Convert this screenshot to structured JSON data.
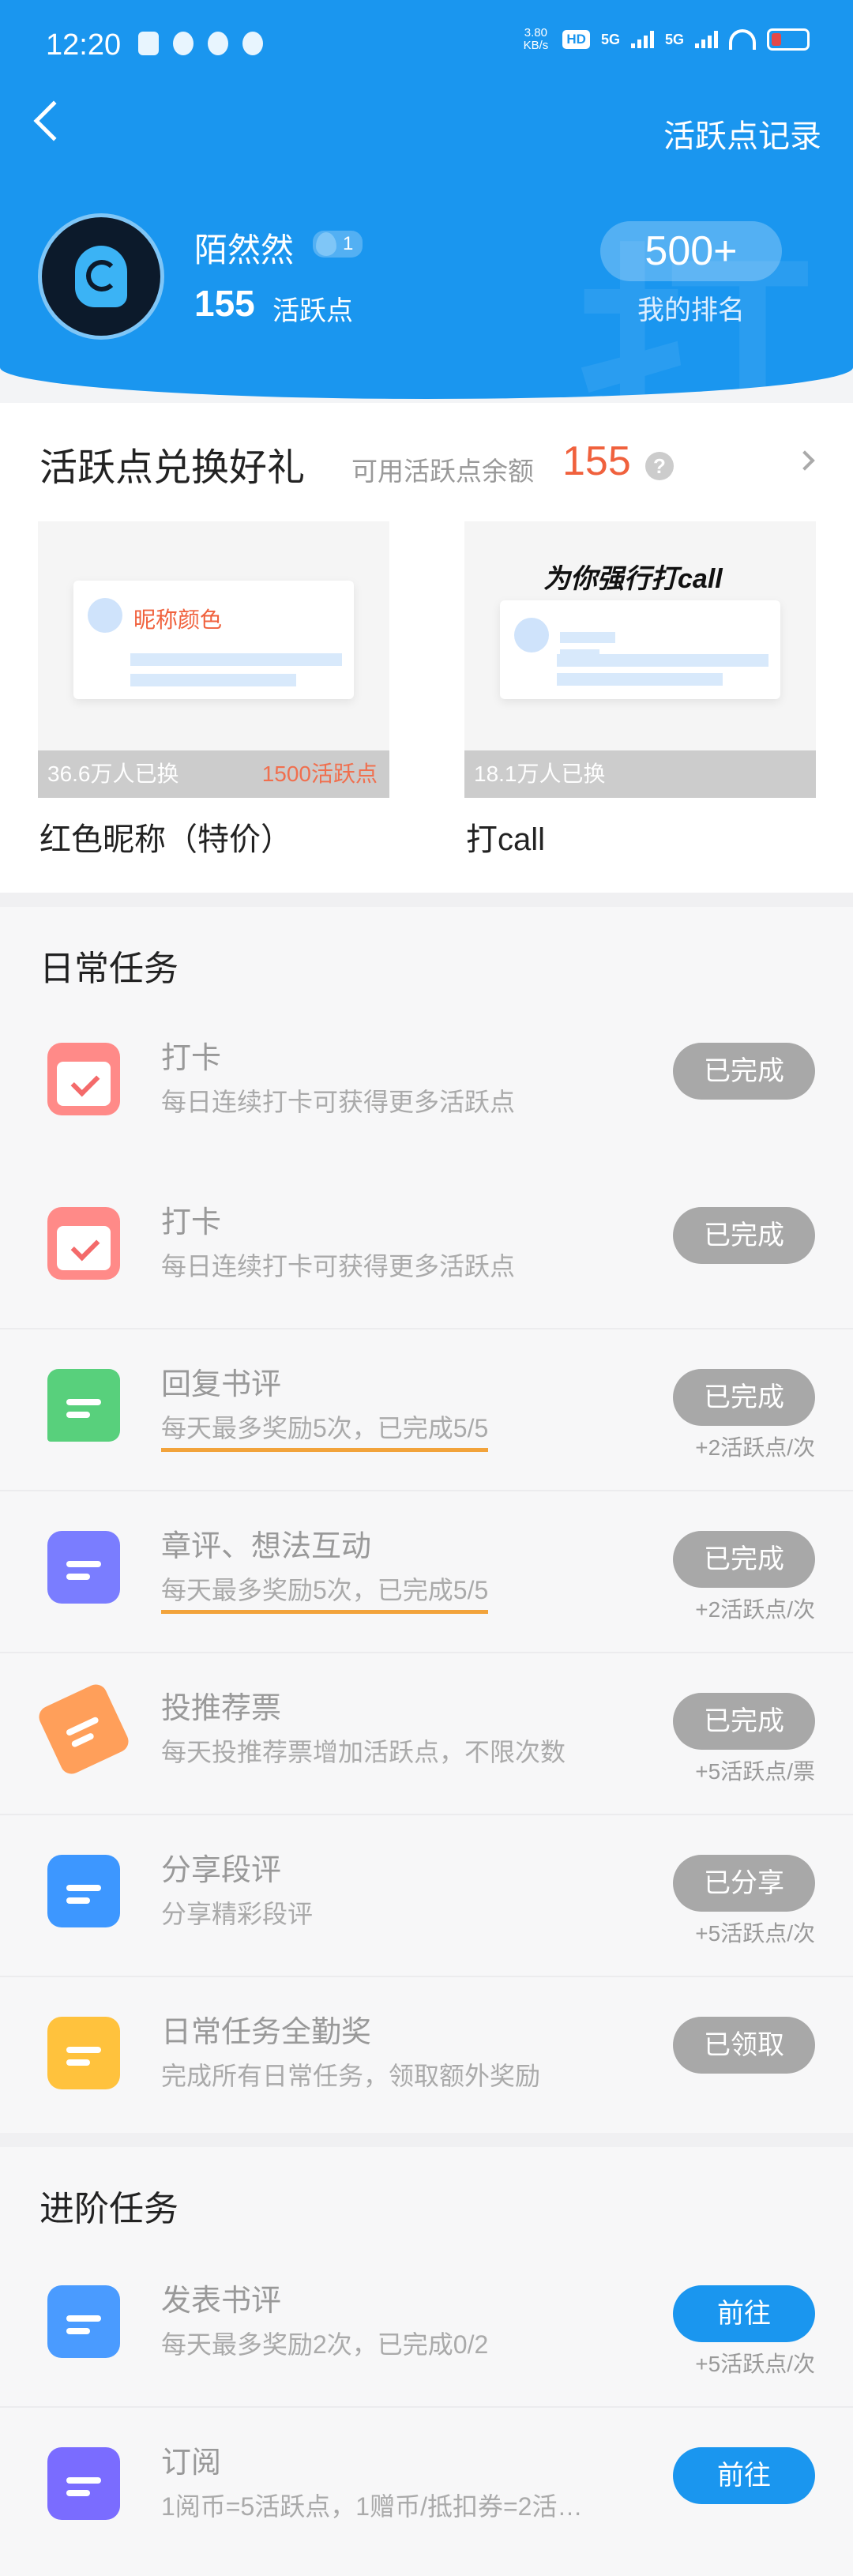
{
  "status_bar": {
    "time": "12:20",
    "net_speed": "3.80 KB/s",
    "hd": "HD",
    "sig1": "5G",
    "sig2": "5G"
  },
  "header": {
    "back": "back",
    "records_link": "活跃点记录"
  },
  "profile": {
    "name": "陌然然",
    "level": "1",
    "points": "155",
    "points_label": "活跃点",
    "rank": "500+",
    "rank_label": "我的排名"
  },
  "redeem": {
    "title": "活跃点兑换好礼",
    "available_label": "可用活跃点余额",
    "balance": "155",
    "items": [
      {
        "name": "红色昵称（特价）",
        "exchanged": "36.6万人已换",
        "cost": "1500活跃点",
        "preview_text": "昵称颜色"
      },
      {
        "name": "打call",
        "exchanged": "18.1万人已换",
        "cost": "",
        "preview_text": "为你强行打call"
      }
    ]
  },
  "daily": {
    "title": "日常任务",
    "tasks": [
      {
        "name": "打卡",
        "desc": "每日连续打卡可获得更多活跃点",
        "button": "已完成",
        "reward": ""
      },
      {
        "name": "打卡",
        "desc": "每日连续打卡可获得更多活跃点",
        "button": "已完成",
        "reward": ""
      },
      {
        "name": "回复书评",
        "desc": "每天最多奖励5次，已完成5/5",
        "button": "已完成",
        "reward": "+2活跃点/次"
      },
      {
        "name": "章评、想法互动",
        "desc": "每天最多奖励5次，已完成5/5",
        "button": "已完成",
        "reward": "+2活跃点/次"
      },
      {
        "name": "投推荐票",
        "desc": "每天投推荐票增加活跃点，不限次数",
        "button": "已完成",
        "reward": "+5活跃点/票"
      },
      {
        "name": "分享段评",
        "desc": "分享精彩段评",
        "button": "已分享",
        "reward": "+5活跃点/次"
      },
      {
        "name": "日常任务全勤奖",
        "desc": "完成所有日常任务，领取额外奖励",
        "button": "已领取",
        "reward": ""
      }
    ]
  },
  "advanced": {
    "title": "进阶任务",
    "tasks": [
      {
        "name": "发表书评",
        "desc": "每天最多奖励2次，已完成0/2",
        "button": "前往",
        "reward": "+5活跃点/次"
      },
      {
        "name": "订阅",
        "desc": "1阅币=5活跃点，1赠币/抵扣券=2活…",
        "button": "前往",
        "reward": ""
      }
    ]
  },
  "colors": {
    "primary": "#1a96ef",
    "accent_red": "#f0613d",
    "done_gray": "#a8a8a8"
  }
}
